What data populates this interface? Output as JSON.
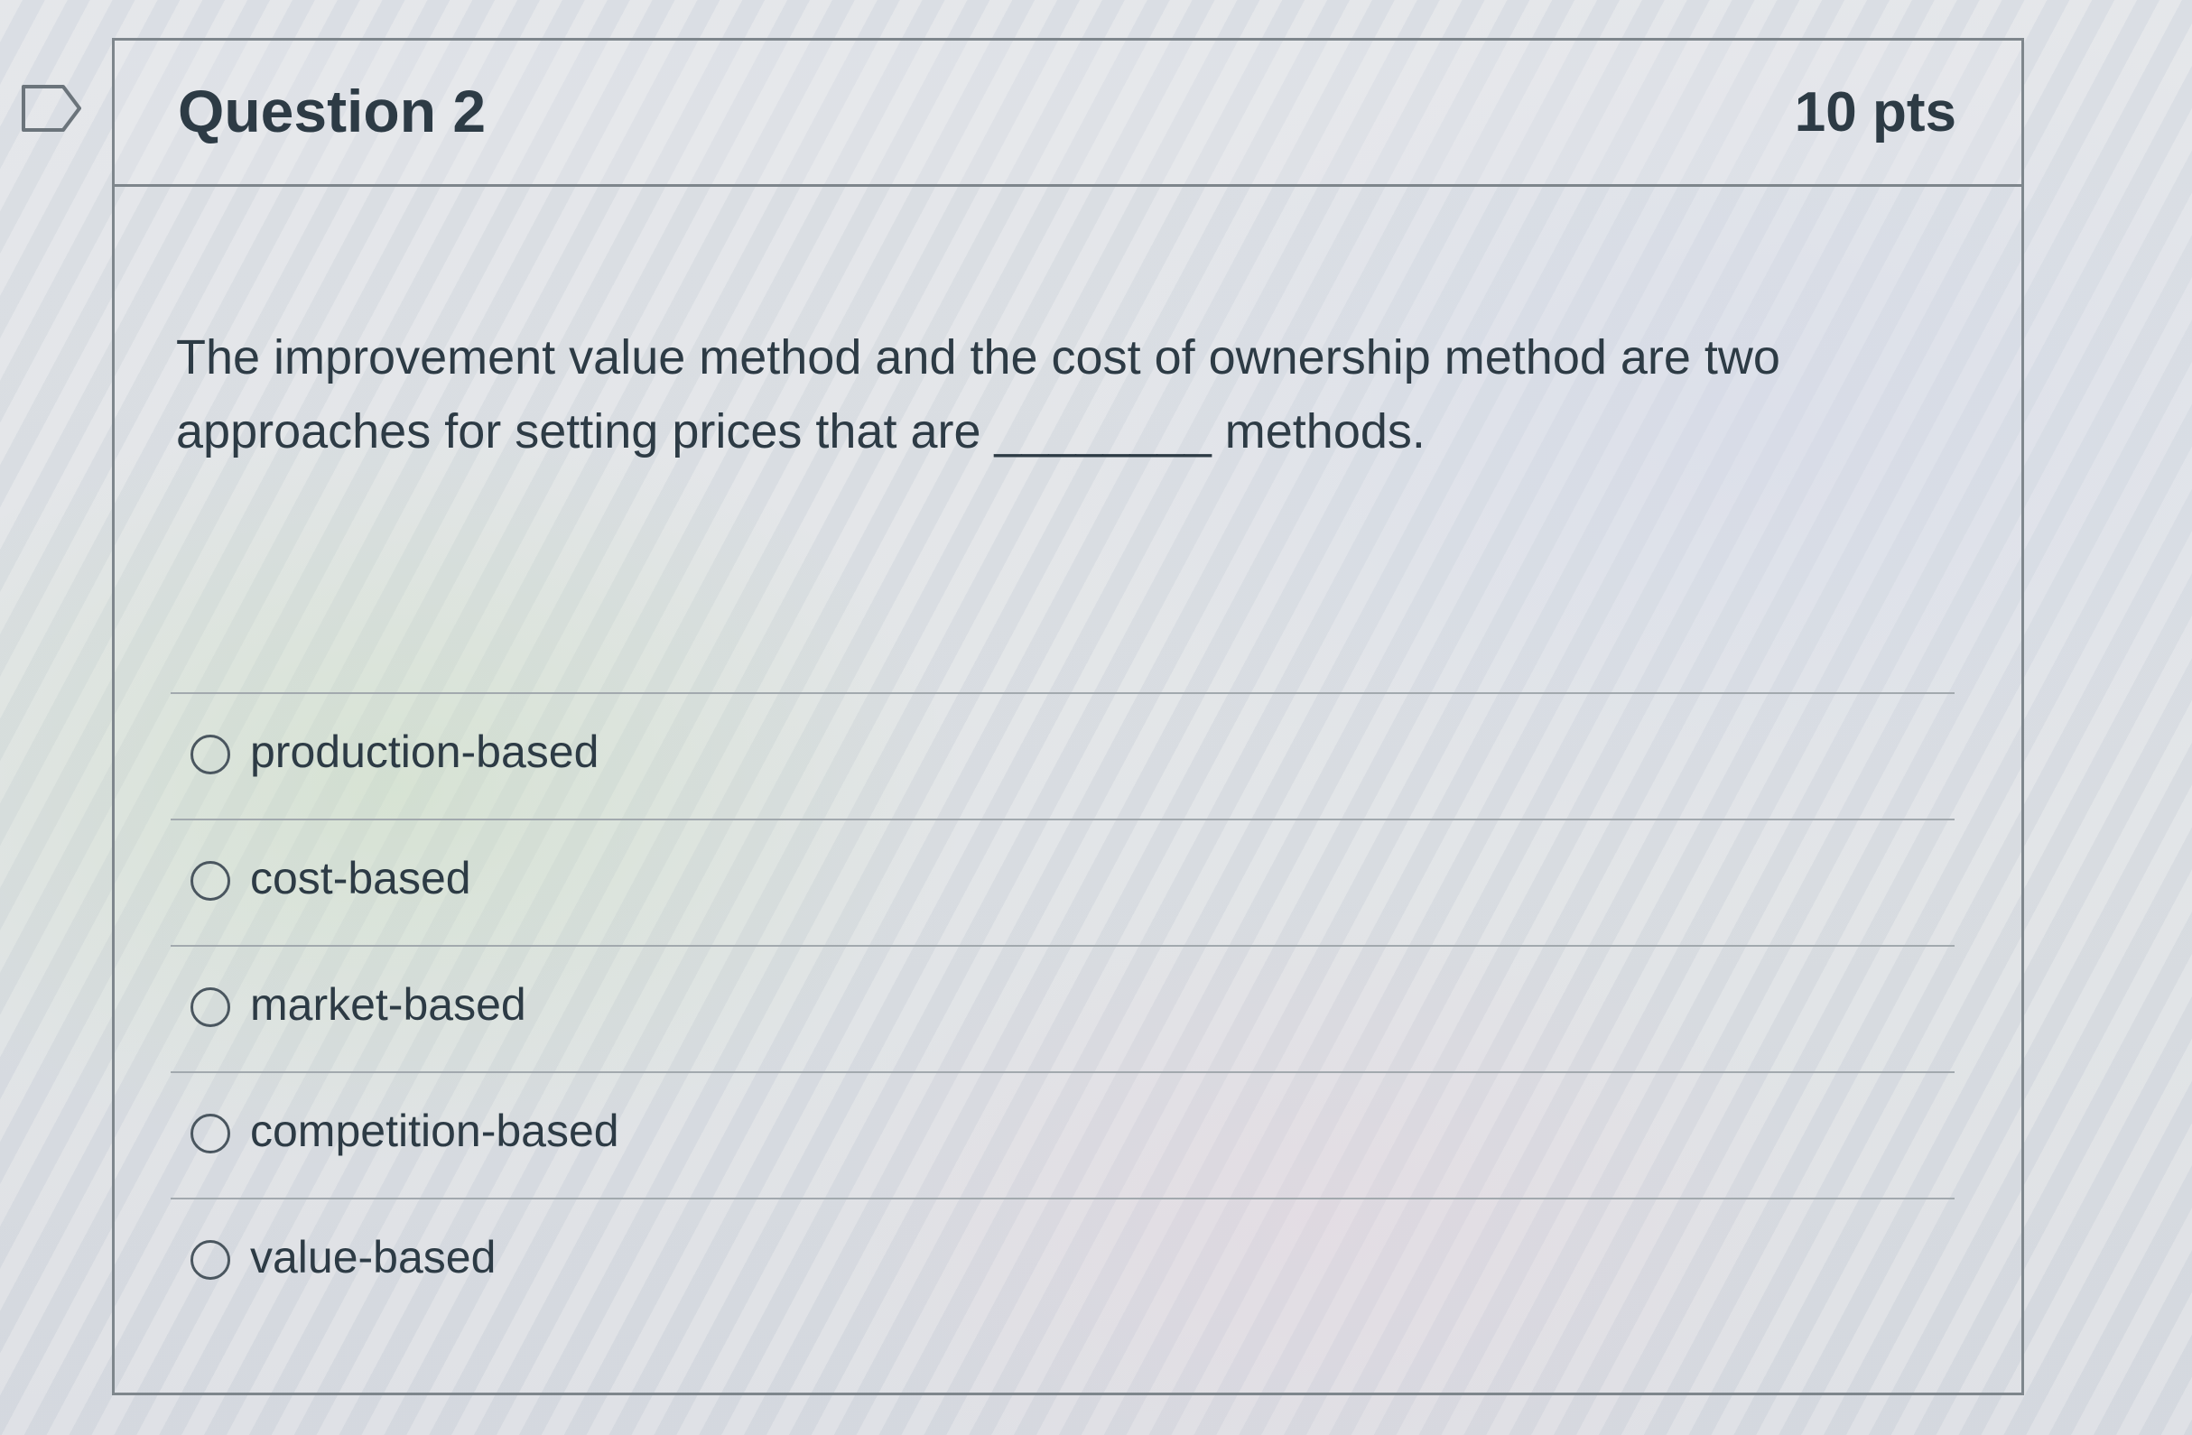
{
  "question": {
    "title": "Question 2",
    "points": "10 pts",
    "text_line1": "The improvement value method and the cost of ownership method are two",
    "text_line2": "approaches for setting prices that are ________ methods."
  },
  "answers": [
    {
      "label": "production-based",
      "selected": false
    },
    {
      "label": "cost-based",
      "selected": false
    },
    {
      "label": "market-based",
      "selected": false
    },
    {
      "label": "competition-based",
      "selected": false
    },
    {
      "label": "value-based",
      "selected": false
    }
  ],
  "icons": {
    "flag": "bookmark-flag-icon",
    "option": "radio-button"
  },
  "colors": {
    "text": "#2d3b45",
    "border": "#7e868c",
    "divider": "#a2a9ae"
  }
}
